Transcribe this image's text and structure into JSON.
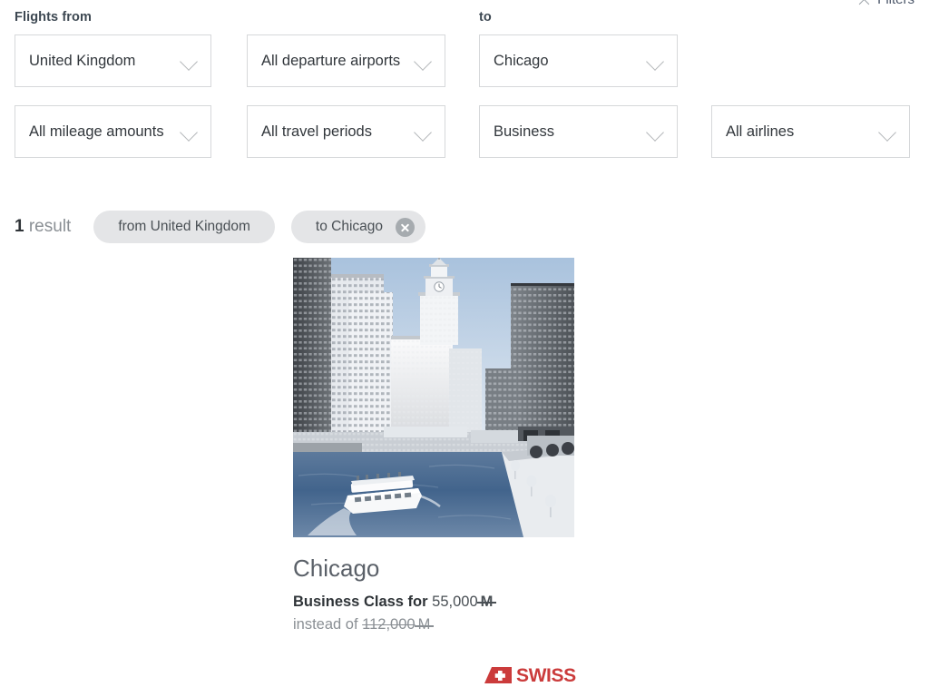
{
  "header": {
    "filters_label": "Filters",
    "filters_icon": "close-x-icon",
    "from_label": "Flights from",
    "to_label": "to"
  },
  "filters": {
    "chevron_icon": "chevron-down-icon",
    "selects": [
      {
        "id": "country",
        "name": "departure-country-select",
        "value": "United Kingdom"
      },
      {
        "id": "airport",
        "name": "departure-airport-select",
        "value": "All departure airports"
      },
      {
        "id": "dest",
        "name": "destination-select",
        "value": "Chicago"
      },
      {
        "id": "mileage",
        "name": "mileage-amount-select",
        "value": "All mileage amounts"
      },
      {
        "id": "period",
        "name": "travel-period-select",
        "value": "All travel periods"
      },
      {
        "id": "cabin",
        "name": "cabin-class-select",
        "value": "Business"
      },
      {
        "id": "airline",
        "name": "airline-select",
        "value": "All airlines"
      }
    ]
  },
  "results": {
    "count": "1",
    "count_noun": "result",
    "chips": [
      {
        "label": "from United Kingdom",
        "removable": false
      },
      {
        "label": "to Chicago",
        "removable": true,
        "close_icon": "close-circle-icon"
      }
    ]
  },
  "offer": {
    "photo_alt": "chicago-skyline-river-photo",
    "destination": "Chicago",
    "price_prefix": "Business Class for",
    "price_amount": "55,000",
    "price_unit": "M",
    "instead_label": "instead of",
    "old_amount": "112,000",
    "old_unit": "M",
    "airline_logo": "swiss-logo",
    "airline_name": "SWISS"
  },
  "colors": {
    "brand_red": "#cb3b3b",
    "chip_bg": "#e4e5e7",
    "border": "#d6d8da",
    "text_dark": "#2f3438",
    "text_muted": "#8a8f94",
    "sky_blue": "#b9cde4"
  }
}
